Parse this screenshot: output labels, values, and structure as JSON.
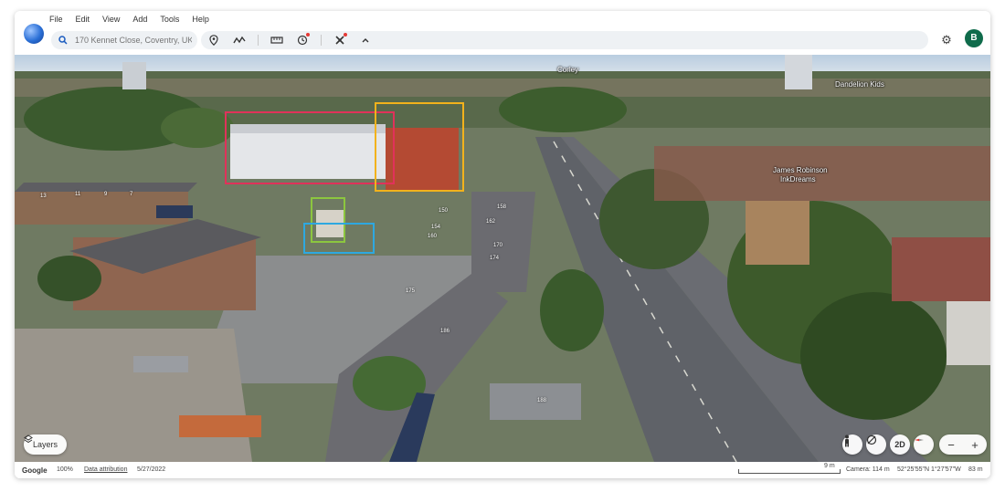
{
  "menu": [
    "File",
    "Edit",
    "View",
    "Add",
    "Tools",
    "Help"
  ],
  "search": {
    "placeholder": "170 Kennet Close, Coventry, UK"
  },
  "toolbar": {
    "icons": [
      "search-icon",
      "place-marker-icon",
      "path-icon",
      "ruler-icon",
      "history-icon",
      "project-icon",
      "chevron-up-icon"
    ]
  },
  "user": {
    "avatar_letter": "B"
  },
  "map": {
    "pois": [
      "Corley",
      "Dandelion Kids",
      "James Robinson",
      "InkDreams"
    ],
    "house_numbers": [
      "13",
      "11",
      "9",
      "7",
      "150",
      "158",
      "162",
      "154",
      "160",
      "170",
      "174",
      "175",
      "186",
      "188"
    ],
    "highlight_colors": {
      "red": "#e0325a",
      "yellow": "#f2b21c",
      "green": "#8cc63f",
      "blue": "#2ea8e0"
    }
  },
  "controls": {
    "layers_label": "Layers",
    "mode_2d_label": "2D",
    "zoom_out": "−",
    "zoom_in": "+"
  },
  "status": {
    "brand": "Google",
    "zoom": "100%",
    "attribution_link": "Data attribution",
    "date": "5/27/2022",
    "scale_label": "9 m",
    "camera": "Camera: 114 m",
    "coords": "52°25'55\"N 1°27'57\"W",
    "elevation": "83 m"
  }
}
